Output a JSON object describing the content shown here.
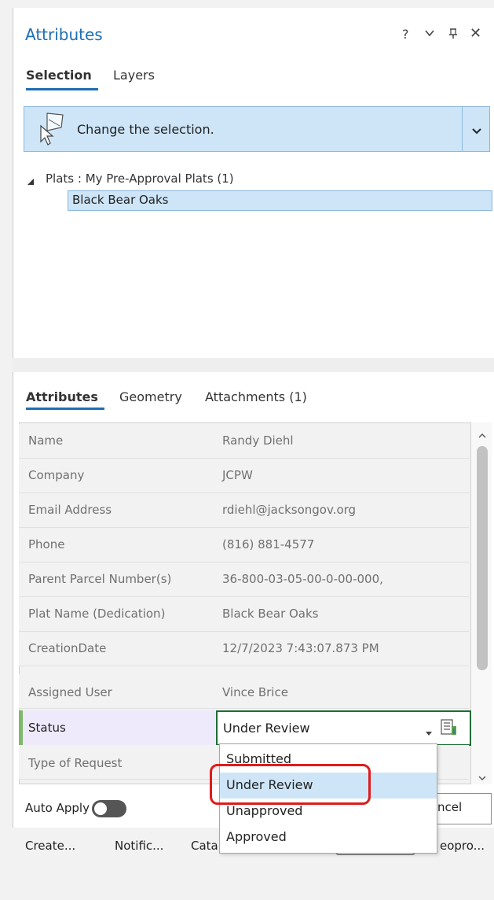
{
  "panel": {
    "title": "Attributes",
    "help": "?",
    "menu": "⌄",
    "pin": "⊥",
    "close": "✕"
  },
  "top_tabs": [
    "Selection",
    "Layers"
  ],
  "banner": {
    "text": "Change the selection.",
    "icon": "selection-pointer-icon"
  },
  "tree": {
    "layer_label": "Plats : My Pre-Approval Plats (1)",
    "selected_feature": "Black Bear Oaks"
  },
  "attr_tabs": [
    "Attributes",
    "Geometry",
    "Attachments (1)"
  ],
  "attributes": [
    {
      "field": "Name",
      "value": "Randy Diehl"
    },
    {
      "field": "Company",
      "value": "JCPW"
    },
    {
      "field": "Email Address",
      "value": "rdiehl@jacksongov.org"
    },
    {
      "field": "Phone",
      "value": "(816) 881-4577"
    },
    {
      "field": "Parent Parcel Number(s)",
      "value": "36-800-03-05-00-0-00-000,"
    },
    {
      "field": "Plat Name (Dedication)",
      "value": "Black Bear Oaks"
    },
    {
      "field": "CreationDate",
      "value": "12/7/2023 7:43:07.873 PM"
    },
    {
      "field": "Assigned User",
      "value": "Vince Brice"
    }
  ],
  "status": {
    "field": "Status",
    "value": "Under Review"
  },
  "type_of_request": {
    "field": "Type of Request"
  },
  "status_options": [
    "Submitted",
    "Under Review",
    "Unapproved",
    "Approved"
  ],
  "bottom": {
    "auto_apply": "Auto Apply",
    "cancel": "ncel"
  },
  "bottom_tabs": [
    "Create...",
    "Notific...",
    "Cata",
    "eopro..."
  ],
  "colors": {
    "accent": "#1c6eb5",
    "highlight": "#cde5f7",
    "status_marker": "#7eb86b",
    "annotation": "#e01b1b"
  }
}
